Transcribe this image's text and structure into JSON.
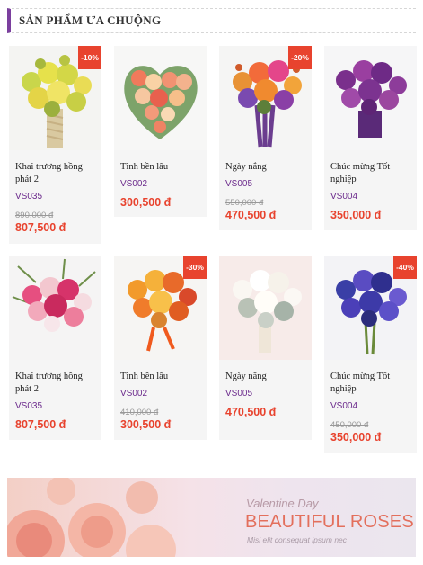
{
  "section": {
    "title": "SẢN PHẨM ƯA CHUỘNG"
  },
  "products": [
    {
      "name": "Khai trương hồng phát 2",
      "sku": "VS035",
      "old_price": "890,000 đ",
      "price": "807,500 đ",
      "badge": "-10%"
    },
    {
      "name": "Tình bền lâu",
      "sku": "VS002",
      "old_price": "",
      "price": "300,500 đ",
      "badge": ""
    },
    {
      "name": "Ngày nắng",
      "sku": "VS005",
      "old_price": "550,000 đ",
      "price": "470,500 đ",
      "badge": "-20%"
    },
    {
      "name": "Chúc mừng Tốt nghiệp",
      "sku": "VS004",
      "old_price": "",
      "price": "350,000 đ",
      "badge": ""
    },
    {
      "name": "Khai trương hồng phát 2",
      "sku": "VS035",
      "old_price": "",
      "price": "807,500 đ",
      "badge": ""
    },
    {
      "name": "Tình bền lâu",
      "sku": "VS002",
      "old_price": "410,000 đ",
      "price": "300,500 đ",
      "badge": "-30%"
    },
    {
      "name": "Ngày nắng",
      "sku": "VS005",
      "old_price": "",
      "price": "470,500 đ",
      "badge": ""
    },
    {
      "name": "Chúc mừng Tốt nghiệp",
      "sku": "VS004",
      "old_price": "450,000 đ",
      "price": "350,000 đ",
      "badge": "-40%"
    }
  ],
  "banner": {
    "subtitle": "Valentine Day",
    "title": "BEAUTIFUL ROSES",
    "tagline": "Misi elit consequat ipsum nec"
  },
  "colors": {
    "accent": "#7b3f9e",
    "price": "#e8432e",
    "sku": "#6b2a8c",
    "badge": "#e8432e"
  }
}
